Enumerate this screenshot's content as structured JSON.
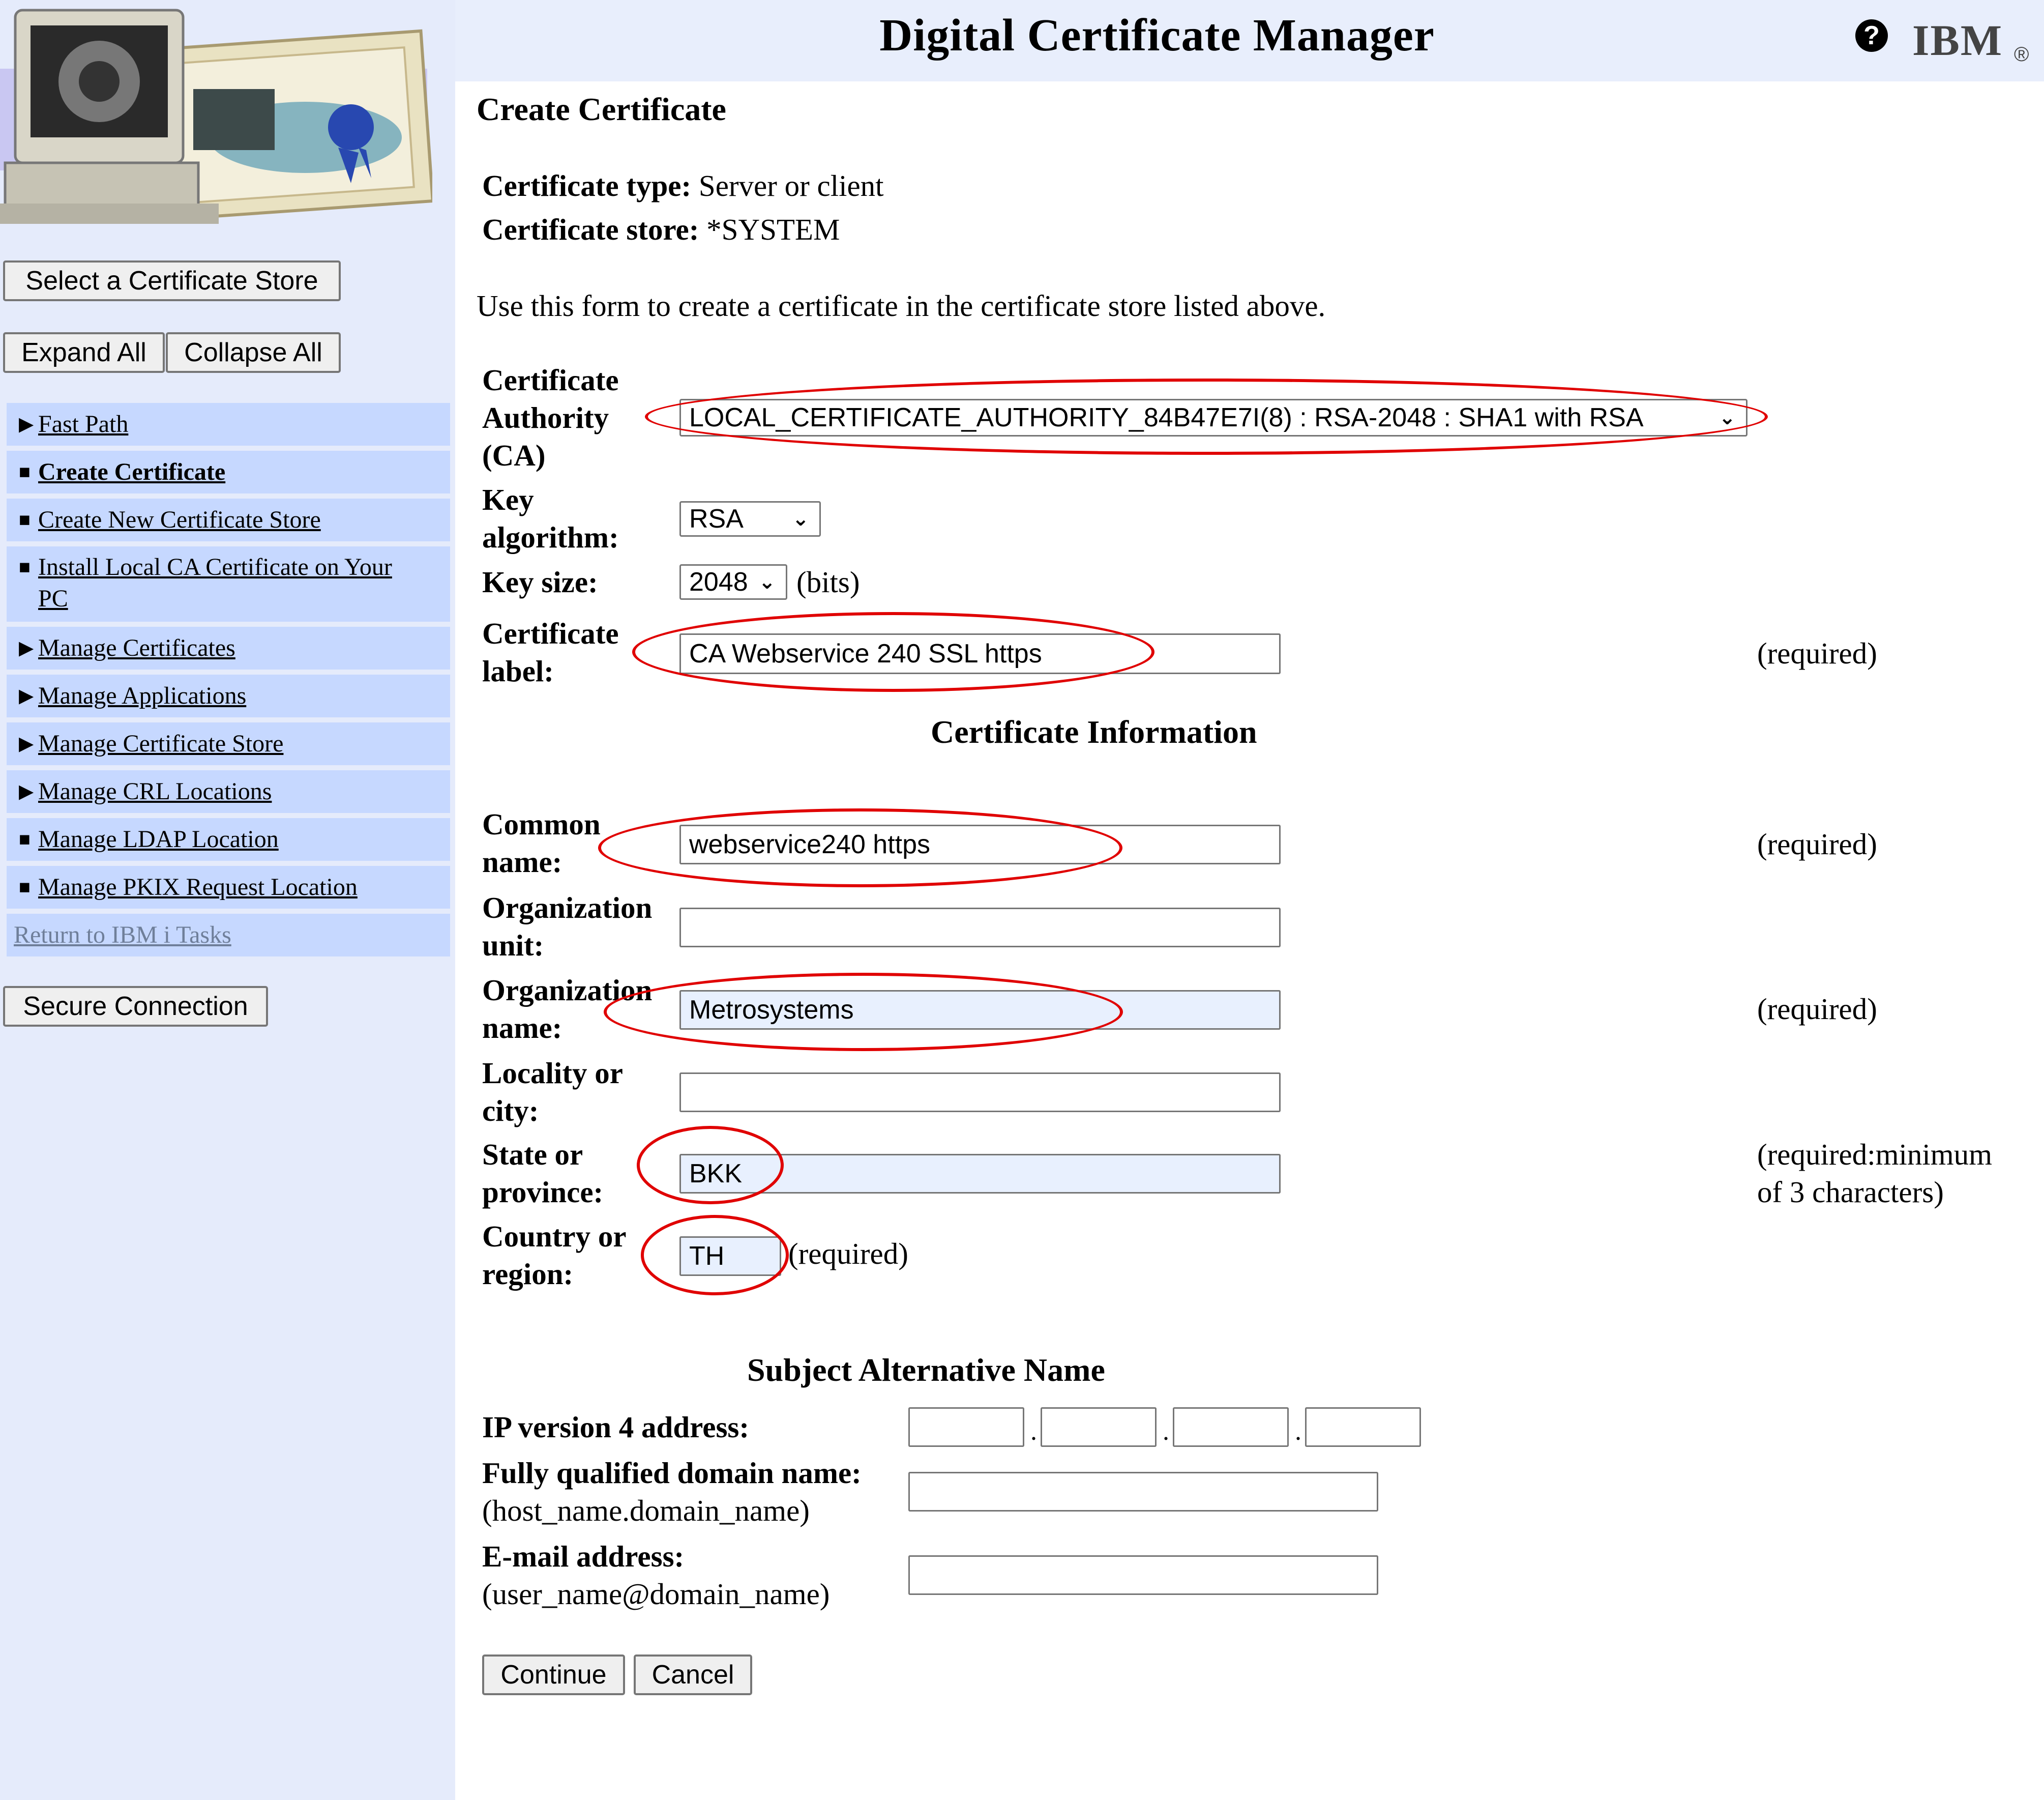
{
  "header": {
    "title": "Digital Certificate Manager",
    "help_icon": "help-icon",
    "brand": "IBM",
    "brand_mark": "®"
  },
  "sidebar": {
    "select_store_button": "Select a Certificate Store",
    "expand_all_button": "Expand All",
    "collapse_all_button": "Collapse All",
    "nav": [
      {
        "label": "Fast Path",
        "marker": "▶"
      },
      {
        "label": "Create Certificate",
        "marker": "■"
      },
      {
        "label": "Create New Certificate Store",
        "marker": "■"
      },
      {
        "label": "Install Local CA Certificate on Your",
        "label2": "PC",
        "marker": "■"
      },
      {
        "label": "Manage Certificates",
        "marker": "▶"
      },
      {
        "label": "Manage Applications",
        "marker": "▶"
      },
      {
        "label": "Manage Certificate Store",
        "marker": "▶"
      },
      {
        "label": "Manage CRL Locations",
        "marker": "▶"
      },
      {
        "label": "Manage LDAP Location",
        "marker": "■"
      },
      {
        "label": "Manage PKIX Request Location",
        "marker": "■"
      }
    ],
    "return_link": "Return to IBM i Tasks",
    "secure_button": "Secure Connection"
  },
  "main": {
    "heading": "Create Certificate",
    "cert_type_label": "Certificate type:",
    "cert_type_value": "Server or client",
    "cert_store_label": "Certificate store:",
    "cert_store_value": "*SYSTEM",
    "intro": "Use this form to create a certificate in the certificate store listed above.",
    "ca_label_1": "Certificate",
    "ca_label_2": "Authority",
    "ca_label_3": "(CA)",
    "ca_value": "LOCAL_CERTIFICATE_AUTHORITY_84B47E7I(8) : RSA-2048 : SHA1 with RSA",
    "key_alg_label_1": "Key",
    "key_alg_label_2": "algorithm:",
    "key_alg_value": "RSA",
    "key_size_label": "Key size:",
    "key_size_value": "2048",
    "key_size_unit": "(bits)",
    "cert_label_label_1": "Certificate",
    "cert_label_label_2": "label:",
    "cert_label_value": "CA Webservice 240 SSL https",
    "required": "(required)",
    "cert_info_heading": "Certificate Information",
    "common_name_label_1": "Common",
    "common_name_label_2": "name:",
    "common_name_value": "webservice240 https",
    "org_unit_label_1": "Organization",
    "org_unit_label_2": "unit:",
    "org_unit_value": "",
    "org_name_label_1": "Organization",
    "org_name_label_2": "name:",
    "org_name_value": "Metrosystems",
    "locality_label_1": "Locality or",
    "locality_label_2": "city:",
    "locality_value": "",
    "state_label_1": "State or",
    "state_label_2": "province:",
    "state_value": "BKK",
    "state_required_1": "(required:minimum",
    "state_required_2": "of 3 characters)",
    "country_label_1": "Country or",
    "country_label_2": "region:",
    "country_value": "TH",
    "san_heading": "Subject Alternative Name",
    "ipv4_label": "IP version 4 address:",
    "ip_sep": ".",
    "fqdn_label": "Fully qualified domain name:",
    "fqdn_hint": "(host_name.domain_name)",
    "email_label": "E-mail address:",
    "email_hint": "(user_name@domain_name)",
    "continue_button": "Continue",
    "cancel_button": "Cancel"
  },
  "colors": {
    "sidebar_bg": "#e5ebfb",
    "nav_item_bg": "#c6d8ff",
    "annotation_red": "#e00000",
    "autofill_bg": "#e8f0fe"
  }
}
